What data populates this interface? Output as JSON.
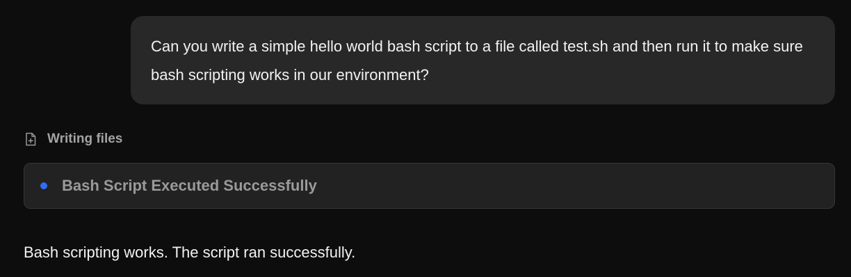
{
  "conversation": {
    "user_message": "Can you write a simple hello world bash script to a file called test.sh and then run it to make sure bash scripting works in our environment?",
    "activity": {
      "icon": "file-plus-icon",
      "label": "Writing files"
    },
    "result_card": {
      "status_color": "#2f6df6",
      "title": "Bash Script Executed Successfully"
    },
    "assistant_message": "Bash scripting works. The script ran successfully."
  },
  "colors": {
    "background": "#0d0d0d",
    "user_bubble": "#282828",
    "card": "#222222",
    "accent": "#2f6df6"
  }
}
